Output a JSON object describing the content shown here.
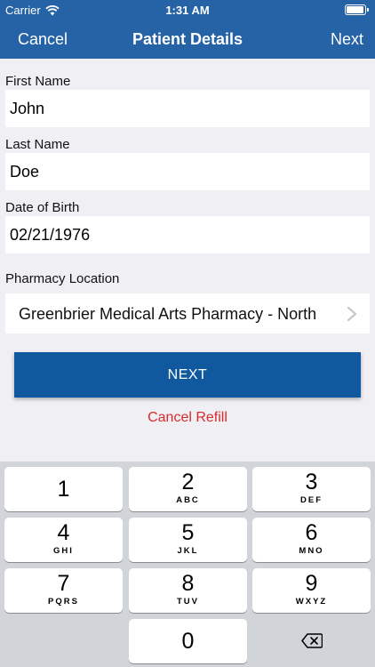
{
  "status_bar": {
    "carrier": "Carrier",
    "time": "1:31 AM",
    "battery_level": 1.0
  },
  "nav": {
    "left_button": "Cancel",
    "title": "Patient Details",
    "right_button": "Next"
  },
  "form": {
    "first_name": {
      "label": "First Name",
      "value": "John"
    },
    "last_name": {
      "label": "Last Name",
      "value": "Doe"
    },
    "dob": {
      "label": "Date of Birth",
      "value": "02/21/1976"
    },
    "pharmacy": {
      "label": "Pharmacy Location",
      "value": "Greenbrier Medical Arts Pharmacy - North"
    }
  },
  "actions": {
    "next_label": "NEXT",
    "cancel_refill_label": "Cancel Refill"
  },
  "keypad": {
    "keys": [
      {
        "digit": "1",
        "letters": ""
      },
      {
        "digit": "2",
        "letters": "ABC"
      },
      {
        "digit": "3",
        "letters": "DEF"
      },
      {
        "digit": "4",
        "letters": "GHI"
      },
      {
        "digit": "5",
        "letters": "JKL"
      },
      {
        "digit": "6",
        "letters": "MNO"
      },
      {
        "digit": "7",
        "letters": "PQRS"
      },
      {
        "digit": "8",
        "letters": "TUV"
      },
      {
        "digit": "9",
        "letters": "WXYZ"
      },
      {
        "digit": "0",
        "letters": ""
      }
    ],
    "delete_icon": "delete-backspace-icon"
  },
  "colors": {
    "nav_bar": "#2563a6",
    "primary_button": "#10599f",
    "cancel_text": "#d62b2b",
    "background": "#f0eff4",
    "keypad_background": "#d1d4d9"
  }
}
